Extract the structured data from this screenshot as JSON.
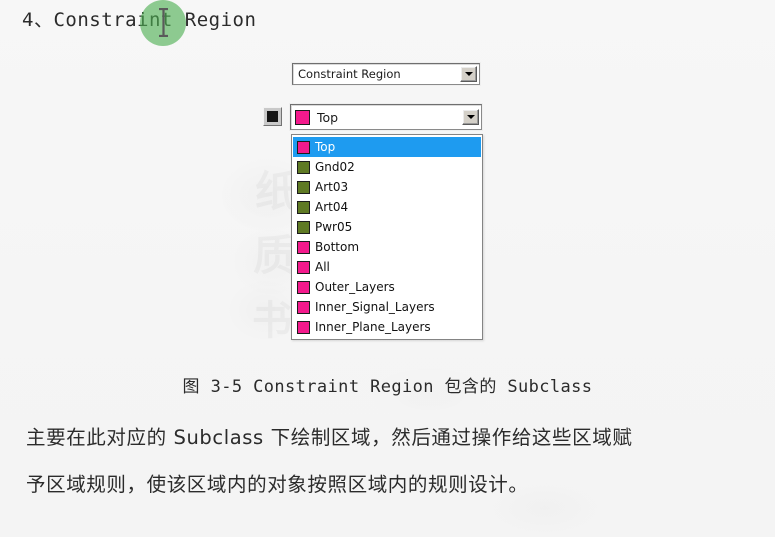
{
  "document": {
    "title": "4、Constraint Region",
    "figure_caption": "图 3-5 Constraint Region 包含的 Subclass",
    "body_line_1": "主要在此对应的 Subclass 下绘制区域，然后通过操作给这些区域赋",
    "body_line_2": "予区域规则，使该区域内的对象按照区域内的规则设计。",
    "watermarks": [
      "纸",
      "质",
      "书"
    ]
  },
  "widget": {
    "class_combo": {
      "value": "Constraint Region",
      "dropdown_icon": "chevron-down-icon"
    },
    "subclass_combo": {
      "value": "Top",
      "swatch_color": "#F31A8C",
      "dropdown_icon": "chevron-down-icon"
    },
    "visibility_toggle": {
      "state": "on",
      "icon": "filled-square-icon"
    },
    "subclass_list": {
      "selected_index": 0,
      "highlight_color": "#1E9BF0",
      "items": [
        {
          "label": "Top",
          "color": "#F31A8C"
        },
        {
          "label": "Gnd02",
          "color": "#5F7A24"
        },
        {
          "label": "Art03",
          "color": "#5F7A24"
        },
        {
          "label": "Art04",
          "color": "#5F7A24"
        },
        {
          "label": "Pwr05",
          "color": "#5F7A24"
        },
        {
          "label": "Bottom",
          "color": "#F31A8C"
        },
        {
          "label": "All",
          "color": "#F31A8C"
        },
        {
          "label": "Outer_Layers",
          "color": "#F31A8C"
        },
        {
          "label": "Inner_Signal_Layers",
          "color": "#F31A8C"
        },
        {
          "label": "Inner_Plane_Layers",
          "color": "#F31A8C"
        }
      ]
    }
  },
  "cursor": {
    "click_highlight_color": "#4CAF50",
    "pointer_type": "text-ibeam"
  }
}
